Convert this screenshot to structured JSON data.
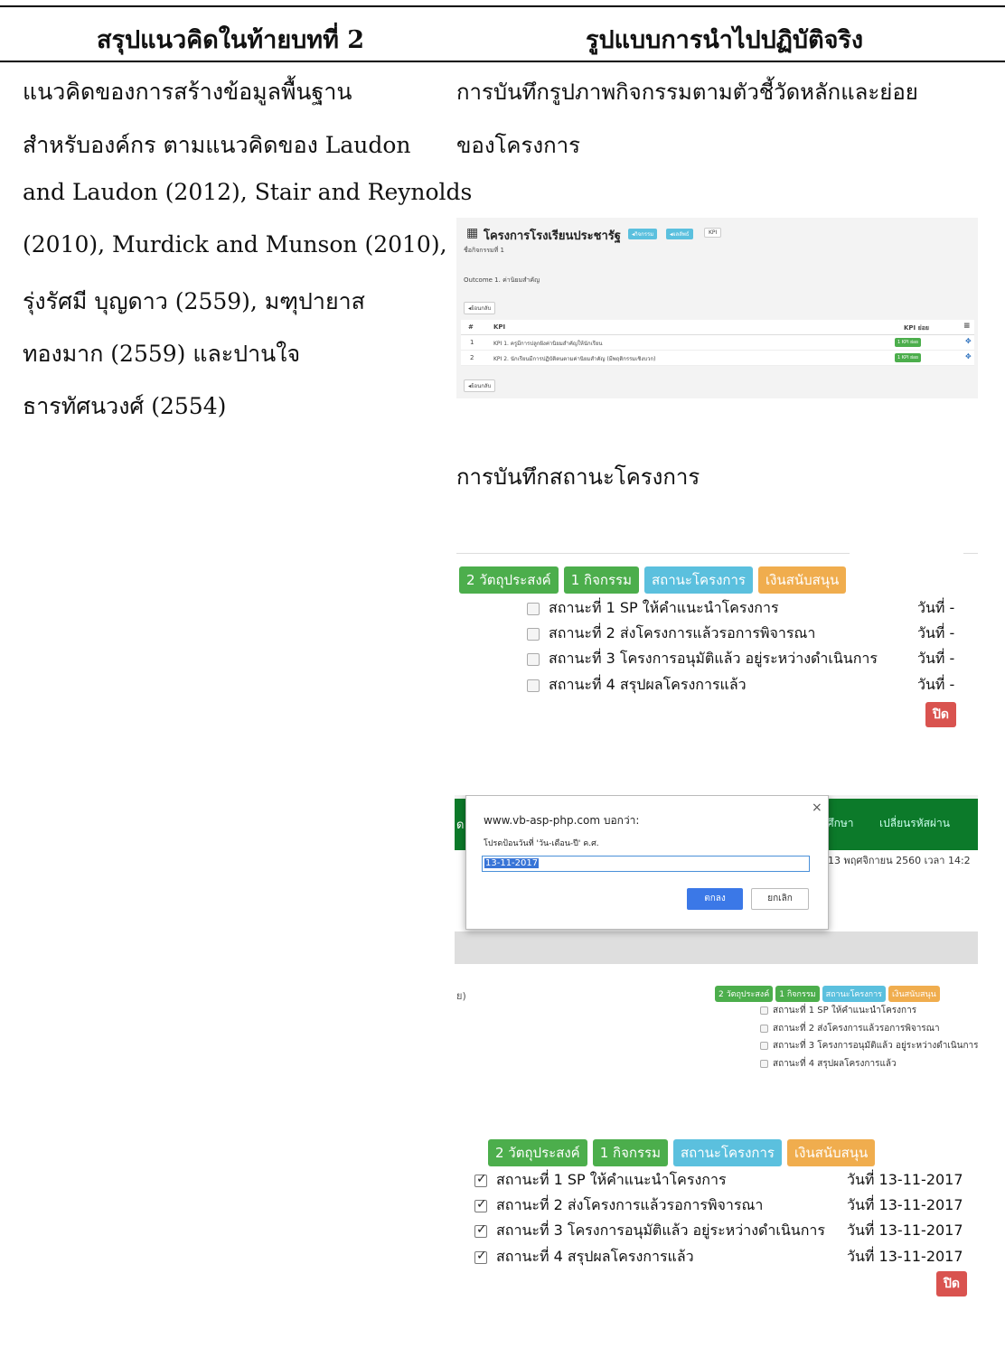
{
  "table": {
    "header_left": "สรุปแนวคิดในท้ายบทที่ 2",
    "header_right": "รูปแบบการนำไปปฏิบัติจริง"
  },
  "left_text": [
    "แนวคิดของการสร้างข้อมูลพื้นฐาน",
    "สำหรับองค์กร ตามแนวคิดของ Laudon",
    "and Laudon (2012), Stair and Reynolds",
    "(2010), Murdick and Munson (2010),",
    "รุ่งรัศมี บุญดาว (2559), มฑุปายาส",
    "ทองมาก (2559) และปานใจ",
    "ธารทัศนวงศ์ (2554)"
  ],
  "right_text": {
    "caption1_line1": "การบันทึกรูปภาพกิจกรรมตามตัวชี้วัดหลักและย่อย",
    "caption1_line2": "ของโครงการ",
    "caption2": "การบันทึกสถานะโครงการ"
  },
  "kpi_shot": {
    "title": "โครงการโรงเรียนประชารัฐ",
    "tag1": "กิจกรรม",
    "tag2": "ผลลัพธ์",
    "tag3": "KPI",
    "activity_name": "ชื่อกิจกรรมที่ 1",
    "outcome": "Outcome 1. ค่านิยมสำคัญ",
    "back": "ย้อนกลับ",
    "col_num": "#",
    "col_kpi": "KPI",
    "col_sub": "KPI ย่อย",
    "rows": [
      {
        "n": "1",
        "kpi": "KPI 1. ครูมีการปลูกฝังค่านิยมสำคัญให้นักเรียน",
        "badge": "1 KPI ย่อย"
      },
      {
        "n": "2",
        "kpi": "KPI 2. นักเรียนมีการปฏิบัติตนตามค่านิยมสำคัญ (มีพฤติกรรมเชิงบวก)",
        "badge": "1 KPI ย่อย"
      }
    ],
    "back2": "ย้อนกลับ"
  },
  "buttons": {
    "objectives": "2 วัตถุประสงค์",
    "activities": "1 กิจกรรม",
    "status": "สถานะโครงการ",
    "funding": "เงินสนับสนุน",
    "close": "ปิด"
  },
  "status_items": [
    "สถานะที่ 1 SP ให้คำแนะนำโครงการ",
    "สถานะที่ 2 ส่งโครงการแล้วรอการพิจารณา",
    "สถานะที่ 3 โครงการอนุมัติแล้ว อยู่ระหว่างดำเนินการ",
    "สถานะที่ 4 สรุปผลโครงการแล้ว"
  ],
  "status_date_empty": "วันที่ -",
  "status_date_filled": "วันที่ 13-11-2017",
  "dialog": {
    "site": "www.vb-asp-php.com บอกว่า:",
    "prompt": "โปรดป้อนวันที่ 'วัน-เดือน-ปี' ค.ศ.",
    "value": "13-11-2017",
    "ok": "ตกลง",
    "cancel": "ยกเลิก",
    "close_x": "×",
    "bg_nav_left": "ด",
    "bg_nav_1": "ศึกษา",
    "bg_nav_2": "เปลี่ยนรหัสผ่าน",
    "bg_date": "13 พฤศจิกายน 2560 เวลา 14:2",
    "bg_paren": "ย)"
  },
  "colors": {
    "green": "#4cae4c",
    "cyan": "#5bc0de",
    "orange": "#f0ad4e",
    "red": "#d9534f",
    "nav": "#0c7a2a"
  }
}
